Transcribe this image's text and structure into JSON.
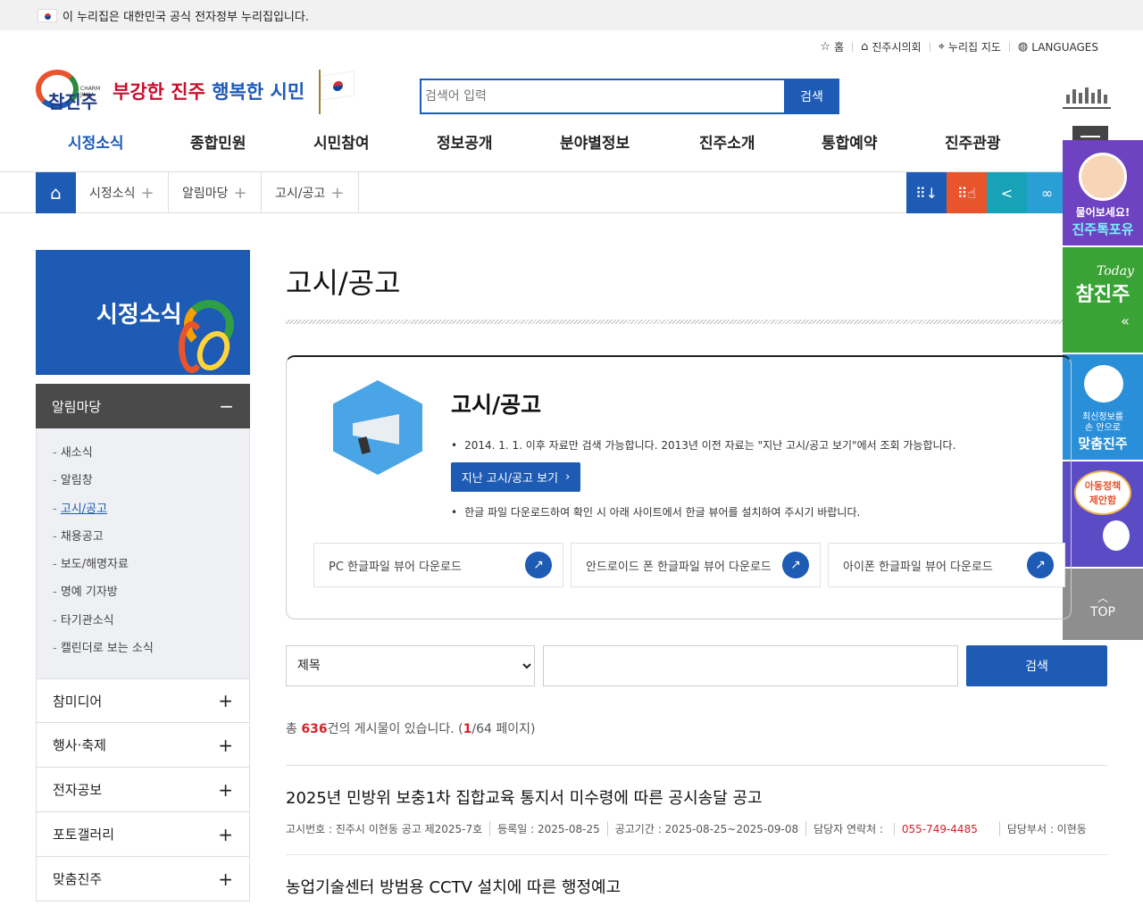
{
  "gov_bar": {
    "text": "이 누리집은 대한민국 공식 전자정부 누리집입니다."
  },
  "utility": {
    "items": [
      {
        "icon": "star-icon",
        "label": "홈"
      },
      {
        "icon": "council-icon",
        "label": "진주시의회"
      },
      {
        "icon": "map-pin-icon",
        "label": "누리집 지도"
      },
      {
        "icon": "globe-icon",
        "label": "LANGUAGES"
      }
    ]
  },
  "brand": {
    "logo_text": "참진주",
    "logo_eng": "CHARM JINJU",
    "slogan_part1": "부강한 진주",
    "slogan_part2": "행복한 시민"
  },
  "header_search": {
    "placeholder": "검색어 입력",
    "button": "검색"
  },
  "gnb": {
    "items": [
      {
        "label": "시정소식",
        "active": true
      },
      {
        "label": "종합민원",
        "active": false
      },
      {
        "label": "시민참여",
        "active": false
      },
      {
        "label": "정보공개",
        "active": false
      },
      {
        "label": "분야별정보",
        "active": false
      },
      {
        "label": "진주소개",
        "active": false
      },
      {
        "label": "통합예약",
        "active": false
      },
      {
        "label": "진주관광",
        "active": false
      }
    ]
  },
  "breadcrumb": {
    "items": [
      "시정소식",
      "알림마당",
      "고시/공고"
    ]
  },
  "tools": {
    "colors": [
      "#1d5bb5",
      "#e8542c",
      "#17a2b8",
      "#2a9fd6"
    ]
  },
  "right_rail": {
    "chatbot": {
      "line1": "물어보세요!",
      "line2": "진주톡포유",
      "color": "#6f42c1"
    },
    "today": {
      "label": "Today",
      "logo": "참진주",
      "color": "#3aa335"
    },
    "custom": {
      "line1": "최신정보를",
      "line2": "손 안으로",
      "line3": "맞춤진주",
      "color": "#2a8fd9"
    },
    "kids": {
      "line1": "아동정책",
      "line2": "제안함",
      "color": "#5b4bc4"
    },
    "top": {
      "label": "TOP"
    }
  },
  "lnb": {
    "hero_title": "시정소식",
    "open_section": "알림마당",
    "sub_items": [
      {
        "label": "새소식",
        "active": false
      },
      {
        "label": "알림창",
        "active": false
      },
      {
        "label": "고시/공고",
        "active": true
      },
      {
        "label": "채용공고",
        "active": false
      },
      {
        "label": "보도/해명자료",
        "active": false
      },
      {
        "label": "명예 기자방",
        "active": false
      },
      {
        "label": "타기관소식",
        "active": false
      },
      {
        "label": "캘린더로 보는 소식",
        "active": false
      }
    ],
    "closed_sections": [
      "참미디어",
      "행사·축제",
      "전자공보",
      "포토갤러리",
      "맞춤진주"
    ]
  },
  "content": {
    "page_title": "고시/공고",
    "info": {
      "title": "고시/공고",
      "note1": "2014. 1. 1. 이후 자료만 검색 가능합니다. 2013년 이전 자료는 \"지난 고시/공고 보기\"에서 조회 가능합니다.",
      "old_button": "지난 고시/공고 보기",
      "note2": "한글 파일 다운로드하여 확인 시 아래 사이트에서 한글 뷰어를 설치하여 주시기 바랍니다.",
      "downloads": [
        "PC 한글파일 뷰어 다운로드",
        "안드로이드 폰 한글파일 뷰어 다운로드",
        "아이폰 한글파일 뷰어 다운로드"
      ]
    },
    "search": {
      "select_value": "제목",
      "button": "검색"
    },
    "total": {
      "prefix": "총",
      "count": "636",
      "middle": "건의 게시물이 있습니다. (",
      "page": "1",
      "suffix": "/64 페이지)"
    },
    "posts": [
      {
        "title": "2025년 민방위 보충1차 집합교육 통지서 미수령에 따른 공시송달 공고",
        "number": "고시번호 : 진주시 이현동 공고 제2025-7호",
        "registered": "등록일 : 2025-08-25",
        "period": "공고기간 : 2025-08-25~2025-09-08",
        "tel_label": "담당자 연락처 : ",
        "tel": "055-749-4485",
        "dept": "담당부서 : 이현동"
      },
      {
        "title": "농업기술센터 방범용 CCTV 설치에 따른 행정예고"
      }
    ]
  }
}
